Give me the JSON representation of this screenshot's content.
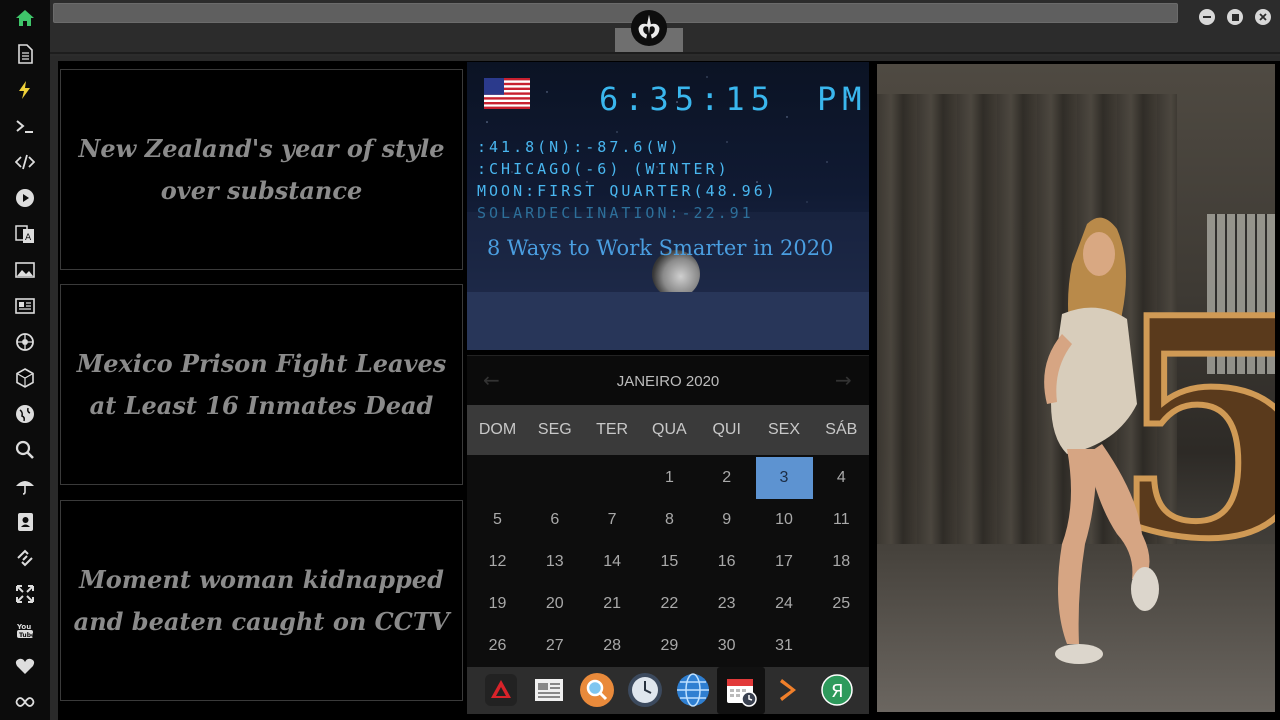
{
  "news": [
    {
      "title": "New Zealand's year of style over substance"
    },
    {
      "title": "Mexico Prison Fight Leaves at Least 16 Inmates Dead"
    },
    {
      "title": "Moment woman kidnapped and beaten caught on CCTV"
    }
  ],
  "clock": {
    "time": "6:35:15",
    "ampm": "PM",
    "coords": ":41.8(N):-87.6(W)",
    "location": ":CHICAGO(-6) (WINTER)",
    "moon": "MOON:FIRST QUARTER(48.96)",
    "solar": "SOLARDECLINATION:-22.91",
    "headline": "8 Ways to Work Smarter in 2020"
  },
  "calendar": {
    "title": "JANEIRO 2020",
    "days_of_week": [
      "DOM",
      "SEG",
      "TER",
      "QUA",
      "QUI",
      "SEX",
      "SÁB"
    ],
    "first_weekday": 3,
    "days_in_month": 31,
    "today": 3
  },
  "sidebar": {
    "items": [
      "home-icon",
      "document-icon",
      "lightning-icon",
      "terminal-icon",
      "code-icon",
      "play-icon",
      "translate-icon",
      "image-icon",
      "news-icon",
      "aperture-icon",
      "cube-icon",
      "globe-icon",
      "search-icon",
      "umbrella-icon",
      "contacts-icon",
      "link-icon",
      "fullscreen-icon",
      "youtube-icon",
      "heart-icon",
      "infinity-icon"
    ]
  },
  "dock": {
    "items": [
      "red-app-icon",
      "news-app-icon",
      "magnifier-app-icon",
      "clock-app-icon",
      "globe-app-icon",
      "calendar-app-icon",
      "play-arrow-app-icon",
      "yandex-app-icon"
    ]
  },
  "colors": {
    "accent_green": "#3fc56a",
    "clock_blue": "#3ab7ee",
    "today_blue": "#5d93d1"
  }
}
